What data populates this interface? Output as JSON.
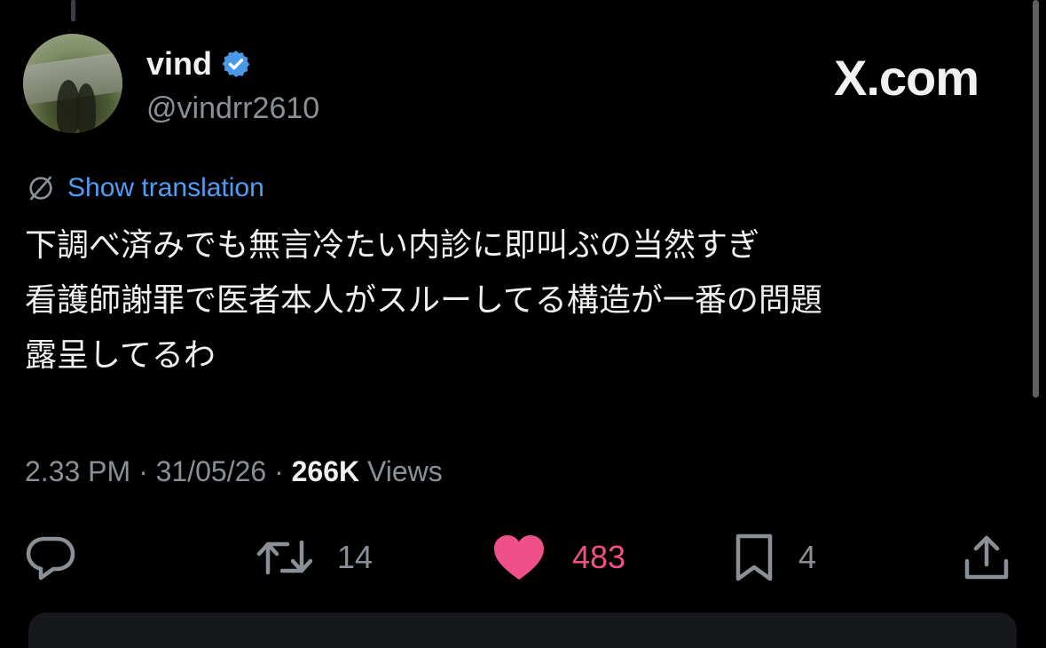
{
  "author": {
    "display_name": "vind",
    "handle": "@vindrr2610",
    "verified": true,
    "verified_color": "#4a99e9"
  },
  "brand": {
    "label": "X.com"
  },
  "translation": {
    "label": "Show translation",
    "icon": "globe-slash-icon",
    "link_color": "#4f9ef5"
  },
  "tweet": {
    "lines": [
      "下調べ済みでも無言冷たい内診に即叫ぶの当然すぎ",
      "看護師謝罪で医者本人がスルーしてる構造が一番の問題",
      "露呈してるわ"
    ]
  },
  "meta": {
    "time": "2.33 PM",
    "separator": "·",
    "date": "31/05/26",
    "views_count": "266K",
    "views_label": "Views"
  },
  "actions": {
    "reply": {
      "icon": "reply-bubble-icon",
      "count": ""
    },
    "repost": {
      "icon": "repost-icon",
      "count": "14"
    },
    "like": {
      "icon": "heart-icon",
      "count": "483",
      "liked": true,
      "color": "#f0508a"
    },
    "bookmark": {
      "icon": "bookmark-icon",
      "count": "4"
    },
    "share": {
      "icon": "share-icon",
      "count": ""
    }
  }
}
